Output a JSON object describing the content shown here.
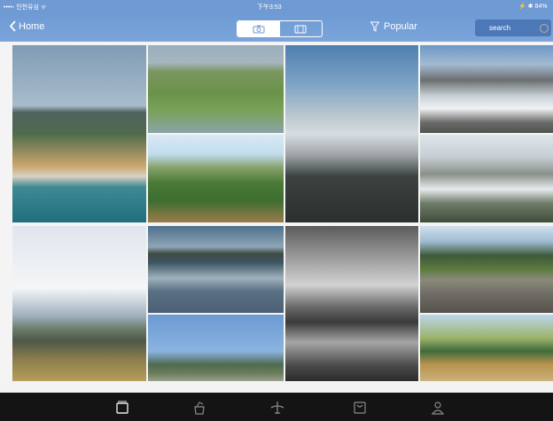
{
  "statusbar": {
    "carrier": "••••◦ 인천유심 ᯤ",
    "time": "下午3:53",
    "battery": "⚡ ✱ 84%"
  },
  "navbar": {
    "back_label": "Home",
    "filter_label": "Popular"
  },
  "search": {
    "placeholder": "search"
  },
  "icons": {
    "back": "chevron-left-icon",
    "photo": "camera-icon",
    "video": "video-icon",
    "filter": "funnel-icon",
    "search": "search-icon",
    "feed": "feed-icon",
    "shop": "bag-icon",
    "flight": "plane-icon",
    "store": "store-icon",
    "profile": "profile-icon"
  },
  "colors": {
    "accent": "#6e9ad4",
    "tabbar": "#141414",
    "search_bg": "#4d78b8"
  }
}
